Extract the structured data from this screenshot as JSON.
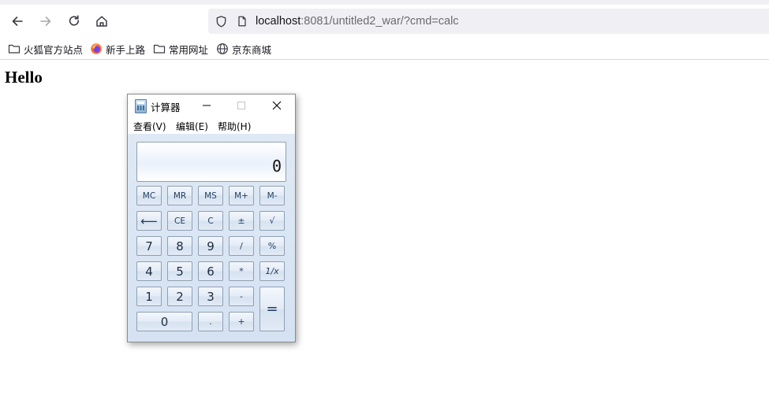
{
  "browser": {
    "url_host": "localhost",
    "url_rest": ":8081/untitled2_war/?cmd=calc",
    "icons": [
      "back-icon",
      "forward-icon",
      "reload-icon",
      "home-icon",
      "shield-icon",
      "page-icon"
    ],
    "bookmarks": [
      {
        "label": "火狐官方站点",
        "icon": "folder-icon"
      },
      {
        "label": "新手上路",
        "icon": "firefox-icon"
      },
      {
        "label": "常用网址",
        "icon": "folder-icon"
      },
      {
        "label": "京东商城",
        "icon": "globe-icon"
      }
    ]
  },
  "page": {
    "heading": "Hello"
  },
  "calculator": {
    "title": "计算器",
    "menu": [
      "查看(V)",
      "编辑(E)",
      "帮助(H)"
    ],
    "display": "0",
    "keys": {
      "mc": "MC",
      "mr": "MR",
      "ms": "MS",
      "mplus": "M+",
      "mminus": "M-",
      "backspace": "⟵",
      "ce": "CE",
      "c": "C",
      "plusminus": "±",
      "sqrt": "√",
      "seven": "7",
      "eight": "8",
      "nine": "9",
      "divide": "/",
      "percent": "%",
      "four": "4",
      "five": "5",
      "six": "6",
      "multiply": "*",
      "reciprocal": "1/x",
      "one": "1",
      "two": "2",
      "three": "3",
      "minus": "-",
      "equals": "=",
      "zero": "0",
      "decimal": ".",
      "plus": "+"
    }
  }
}
